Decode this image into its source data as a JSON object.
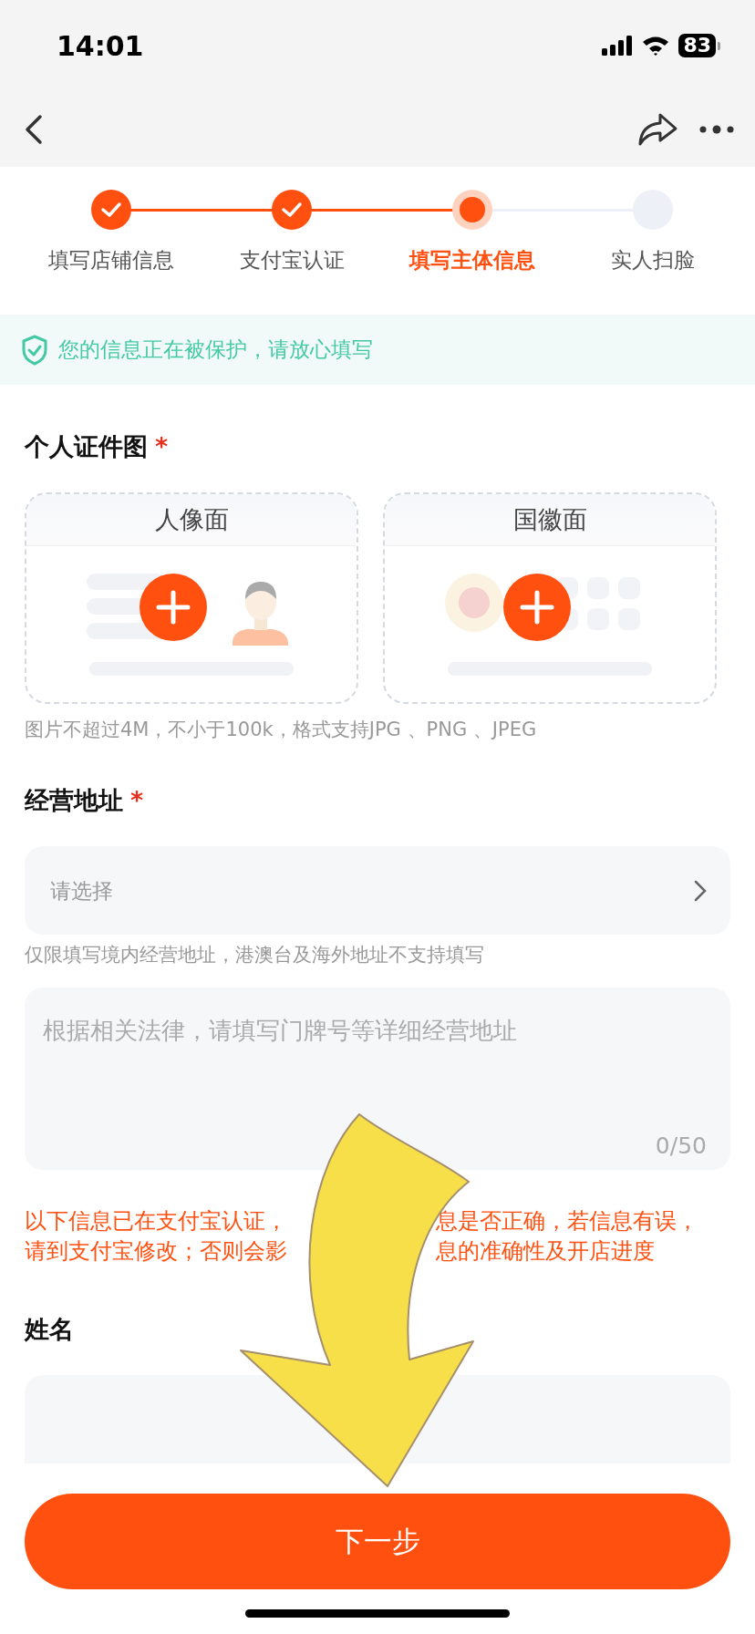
{
  "status_bar": {
    "time": "14:01",
    "battery": "83"
  },
  "steps": [
    {
      "label": "填写店铺信息",
      "kind": "done"
    },
    {
      "label": "支付宝认证",
      "kind": "done"
    },
    {
      "label": "填写主体信息",
      "kind": "current"
    },
    {
      "label": "实人扫脸",
      "kind": "todo"
    }
  ],
  "notice": "您的信息正在被保护，请放心填写",
  "id_photos": {
    "title": "个人证件图",
    "required_mark": "*",
    "cards": [
      {
        "label": "人像面",
        "kind": "portrait"
      },
      {
        "label": "国徽面",
        "kind": "emblem"
      }
    ],
    "hint": "图片不超过4M，不小于100k，格式支持JPG 、PNG 、JPEG"
  },
  "address": {
    "title": "经营地址",
    "required_mark": "*",
    "select": {
      "placeholder": "请选择"
    },
    "hint": "仅限填写境内经营地址，港澳台及海外地址不支持填写",
    "detail": {
      "placeholder": "根据相关法律，请填写门牌号等详细经营地址",
      "counter": "0/50"
    }
  },
  "warning_lines": [
    {
      "left": "以下信息已在支付宝认证，",
      "right": "息是否正确，若信息有误，"
    },
    {
      "left": "请到支付宝修改；否则会影",
      "right": "息的准确性及开店进度"
    }
  ],
  "name": {
    "title": "姓名"
  },
  "next_button": "下一步"
}
